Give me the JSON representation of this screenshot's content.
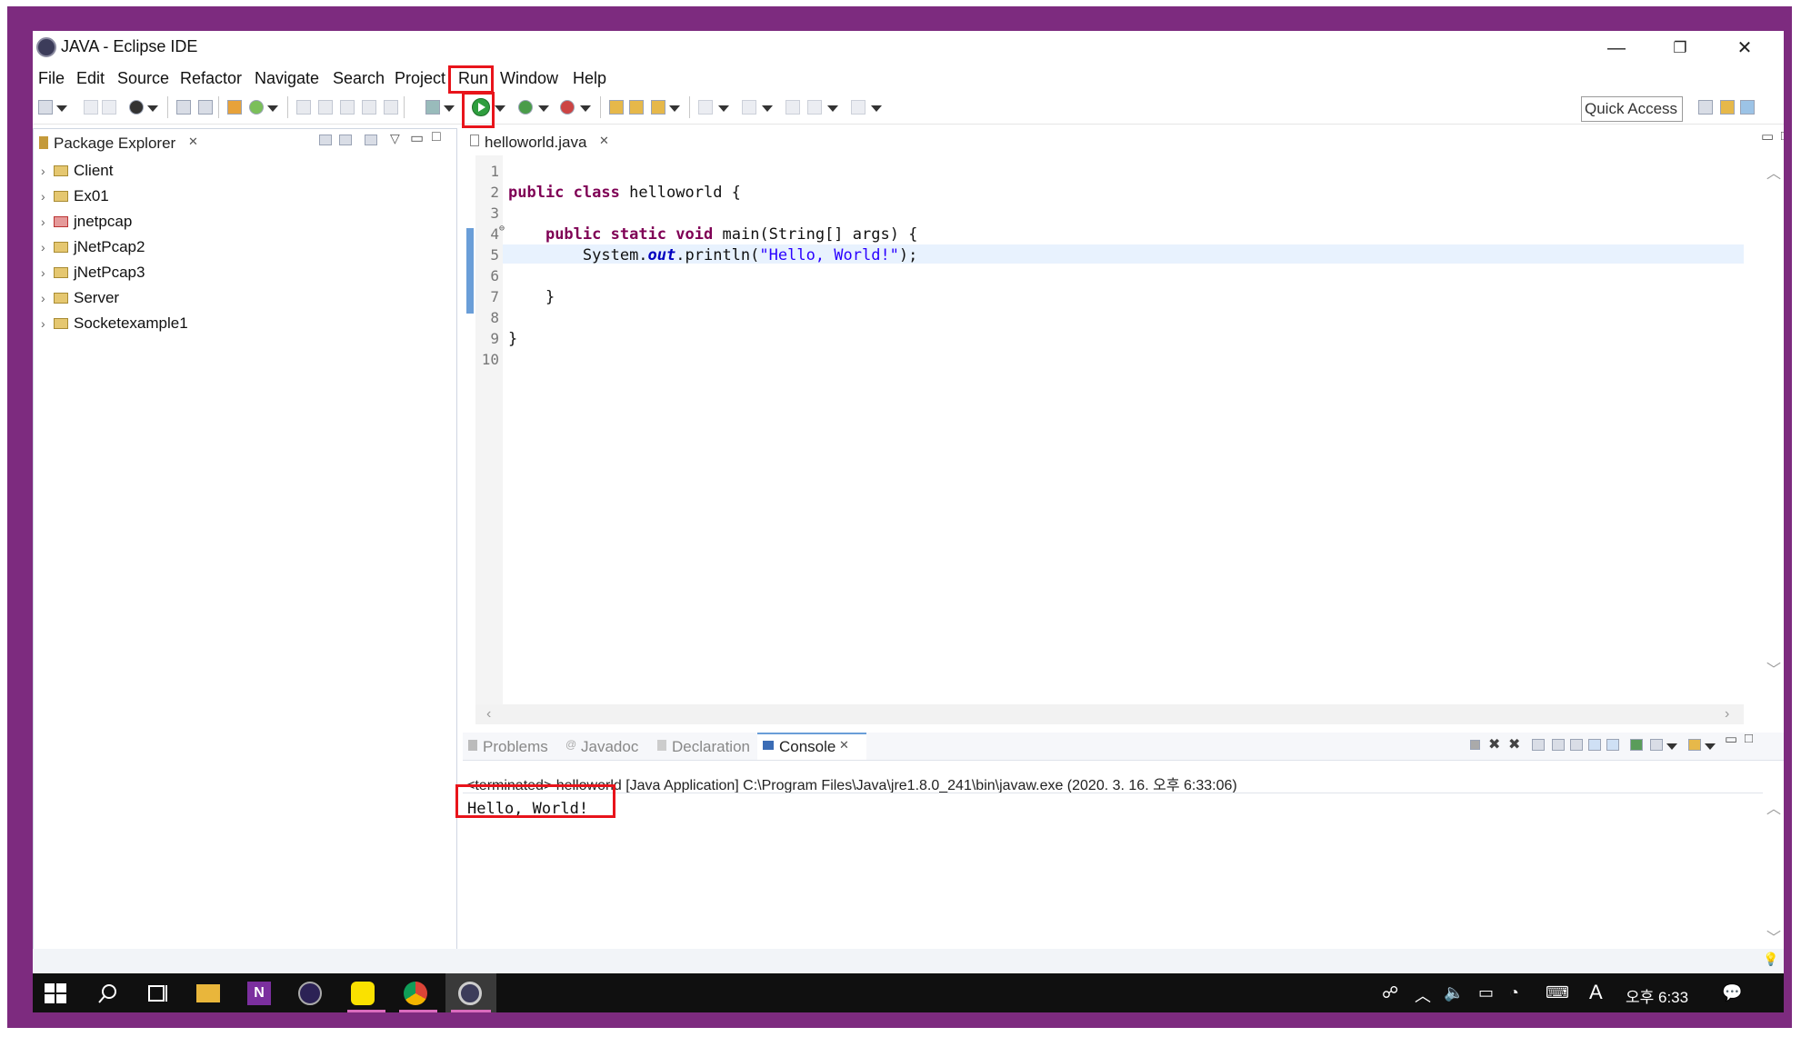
{
  "window": {
    "title": "JAVA - Eclipse IDE",
    "minimize": "—",
    "restore": "❐",
    "close": "✕"
  },
  "menu": [
    "File",
    "Edit",
    "Source",
    "Refactor",
    "Navigate",
    "Search",
    "Project",
    "Run",
    "Window",
    "Help"
  ],
  "toolbar": {
    "quick_access": "Quick Access"
  },
  "package_explorer": {
    "title": "Package Explorer",
    "projects": [
      "Client",
      "Ex01",
      "jnetpcap",
      "jNetPcap2",
      "jNetPcap3",
      "Server",
      "Socketexample1"
    ]
  },
  "editor": {
    "tab": "helloworld.java",
    "line_numbers": [
      "1",
      "2",
      "3",
      "4",
      "5",
      "6",
      "7",
      "8",
      "9",
      "10"
    ],
    "lines": [
      "",
      "public class helloworld {",
      "",
      "    public static void main(String[] args) {",
      "        System.out.println(\"Hello, World!\");",
      "",
      "    }",
      "",
      "}",
      ""
    ],
    "code_parts": {
      "kw_public": "public",
      "kw_class": "class",
      "class_rest": " helloworld {",
      "kw_public2": "public",
      "kw_static": "static",
      "kw_void": "void",
      "main_rest": " main(String[] args) {",
      "sys": "System.",
      "out": "out",
      "println": ".println(",
      "literal": "\"Hello, World!\"",
      "end": ");",
      "close_brace_inner": "}",
      "close_brace_outer": "}"
    }
  },
  "bottom_tabs": [
    "Problems",
    "Javadoc",
    "Declaration",
    "Console"
  ],
  "console": {
    "status": "<terminated> helloworld [Java Application] C:\\Program Files\\Java\\jre1.8.0_241\\bin\\javaw.exe (2020. 3. 16. 오후 6:33:06)",
    "output": "Hello, World!"
  },
  "taskbar": {
    "time": "오후 6:33",
    "ime": "A"
  },
  "colors": {
    "frame": "#7d2b7f",
    "highlight": "#e8141b",
    "keyword": "#7f0055",
    "string": "#2a00ff"
  }
}
